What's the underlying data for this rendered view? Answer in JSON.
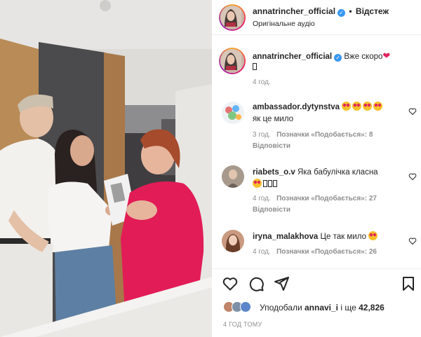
{
  "header": {
    "username": "annatrincher_official",
    "follow_label": "Відстеж",
    "audio_label": "Оригінальне аудіо"
  },
  "caption": {
    "username": "annatrincher_official",
    "text": "Вже скоро",
    "time": "4 год."
  },
  "comments": [
    {
      "username": "ambassador.dytynstva",
      "line2": "як це мило",
      "time": "3 год.",
      "likes_label": "Позначки «Подобається»: 8",
      "reply_label": "Відповісти"
    },
    {
      "username": "riabets_o.v",
      "text": "Яка бабулічка класна",
      "time": "4 год.",
      "likes_label": "Позначки «Подобається»: 27",
      "reply_label": "Відповісти"
    },
    {
      "username": "iryna_malakhova",
      "text": "Це так мило",
      "time": "4 год.",
      "likes_label": "Позначки «Подобається»: 26"
    }
  ],
  "likes": {
    "prefix": "Уподобали ",
    "user": "annavi_i",
    "middle": " і ще ",
    "count": "42,826"
  },
  "post_time": "4 ГОД ТОМУ",
  "colors": {
    "verified": "#3897f0",
    "muted_text": "#8e8e8e",
    "heart_red": "#e0245e",
    "divider": "#efefef"
  }
}
